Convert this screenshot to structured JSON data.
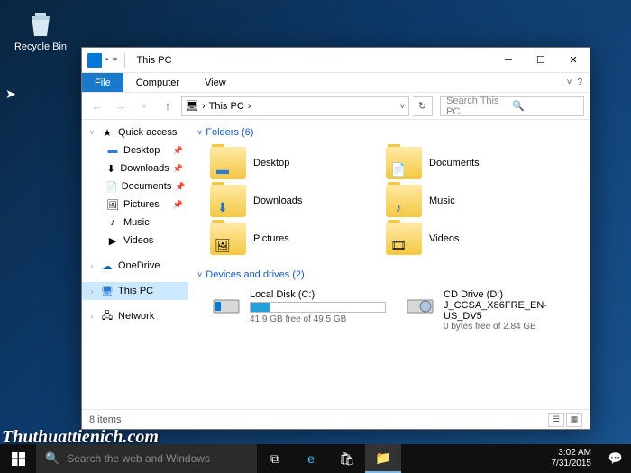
{
  "desktop": {
    "recycle_bin": "Recycle Bin"
  },
  "window": {
    "title": "This PC",
    "ribbon": {
      "file": "File",
      "computer": "Computer",
      "view": "View"
    },
    "address": {
      "location": "This PC",
      "sep": "›"
    },
    "search": {
      "placeholder": "Search This PC"
    },
    "nav": {
      "quick_access": "Quick access",
      "desktop": "Desktop",
      "downloads": "Downloads",
      "documents": "Documents",
      "pictures": "Pictures",
      "music": "Music",
      "videos": "Videos",
      "onedrive": "OneDrive",
      "this_pc": "This PC",
      "network": "Network"
    },
    "sections": {
      "folders_hdr": "Folders (6)",
      "drives_hdr": "Devices and drives (2)"
    },
    "folders": {
      "desktop": "Desktop",
      "documents": "Documents",
      "downloads": "Downloads",
      "music": "Music",
      "pictures": "Pictures",
      "videos": "Videos"
    },
    "drives": {
      "c": {
        "name": "Local Disk (C:)",
        "sub": "41.9 GB free of 49.5 GB",
        "fill": 15
      },
      "d": {
        "name": "CD Drive (D:)",
        "line2": "J_CCSA_X86FRE_EN-US_DV5",
        "sub": "0 bytes free of 2.84 GB"
      }
    },
    "status": {
      "count": "8 items"
    }
  },
  "taskbar": {
    "search_placeholder": "Search the web and Windows",
    "time": "3:02 AM",
    "date": "7/31/2015"
  },
  "watermark": "Thuthuattienich.com"
}
